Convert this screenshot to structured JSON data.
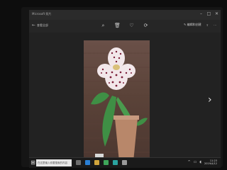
{
  "window": {
    "title": "Microsoft 照片"
  },
  "toolbar": {
    "back_label": "查看全部",
    "icons": [
      "zoom-icon",
      "delete-icon",
      "favorite-icon",
      "rotate-icon"
    ],
    "edit_label": "编辑和创建",
    "share_icon": "share-icon",
    "more_icon": "more-icon"
  },
  "viewer": {
    "next_icon": "›",
    "fullscreen_icon": "⤢"
  },
  "taskbar": {
    "search_placeholder": "在这里输入你要搜索的内容",
    "time": "11:23",
    "date": "2019/4/12"
  },
  "colors": {
    "screen_bg": "#232323",
    "taskbar_bg": "#1a1a1a",
    "flower_petal": "#f2e7ea",
    "flower_spot": "#7a1e38",
    "leaf_green": "#3f8f45",
    "pot": "#b8876a"
  }
}
